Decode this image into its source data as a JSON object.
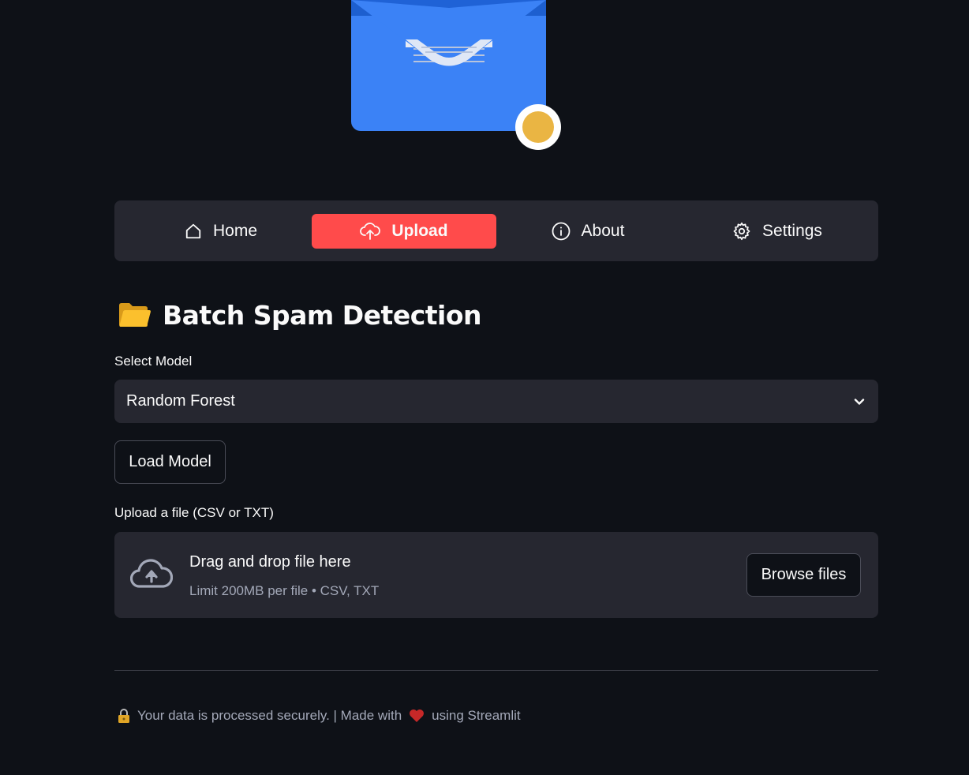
{
  "nav": {
    "items": [
      {
        "label": "Home",
        "icon": "house-icon"
      },
      {
        "label": "Upload",
        "icon": "cloud-upload-icon",
        "active": true
      },
      {
        "label": "About",
        "icon": "info-icon"
      },
      {
        "label": "Settings",
        "icon": "gear-icon"
      }
    ],
    "active_color": "#ff4b4b"
  },
  "page": {
    "title_icon": "folder-icon",
    "title": "Batch Spam Detection"
  },
  "model_select": {
    "label": "Select Model",
    "value": "Random Forest"
  },
  "load_button": "Load Model",
  "uploader": {
    "label": "Upload a file (CSV or TXT)",
    "title": "Drag and drop file here",
    "subtitle": "Limit 200MB per file • CSV, TXT",
    "browse_label": "Browse files"
  },
  "footer": {
    "text_before": "Your data is processed securely. | Made with",
    "text_after": "using Streamlit"
  },
  "colors": {
    "background": "#0e1117",
    "panel": "#262730",
    "accent": "#ff4b4b",
    "envelope_blue": "#3b82f6",
    "badge_yellow": "#eab543"
  }
}
